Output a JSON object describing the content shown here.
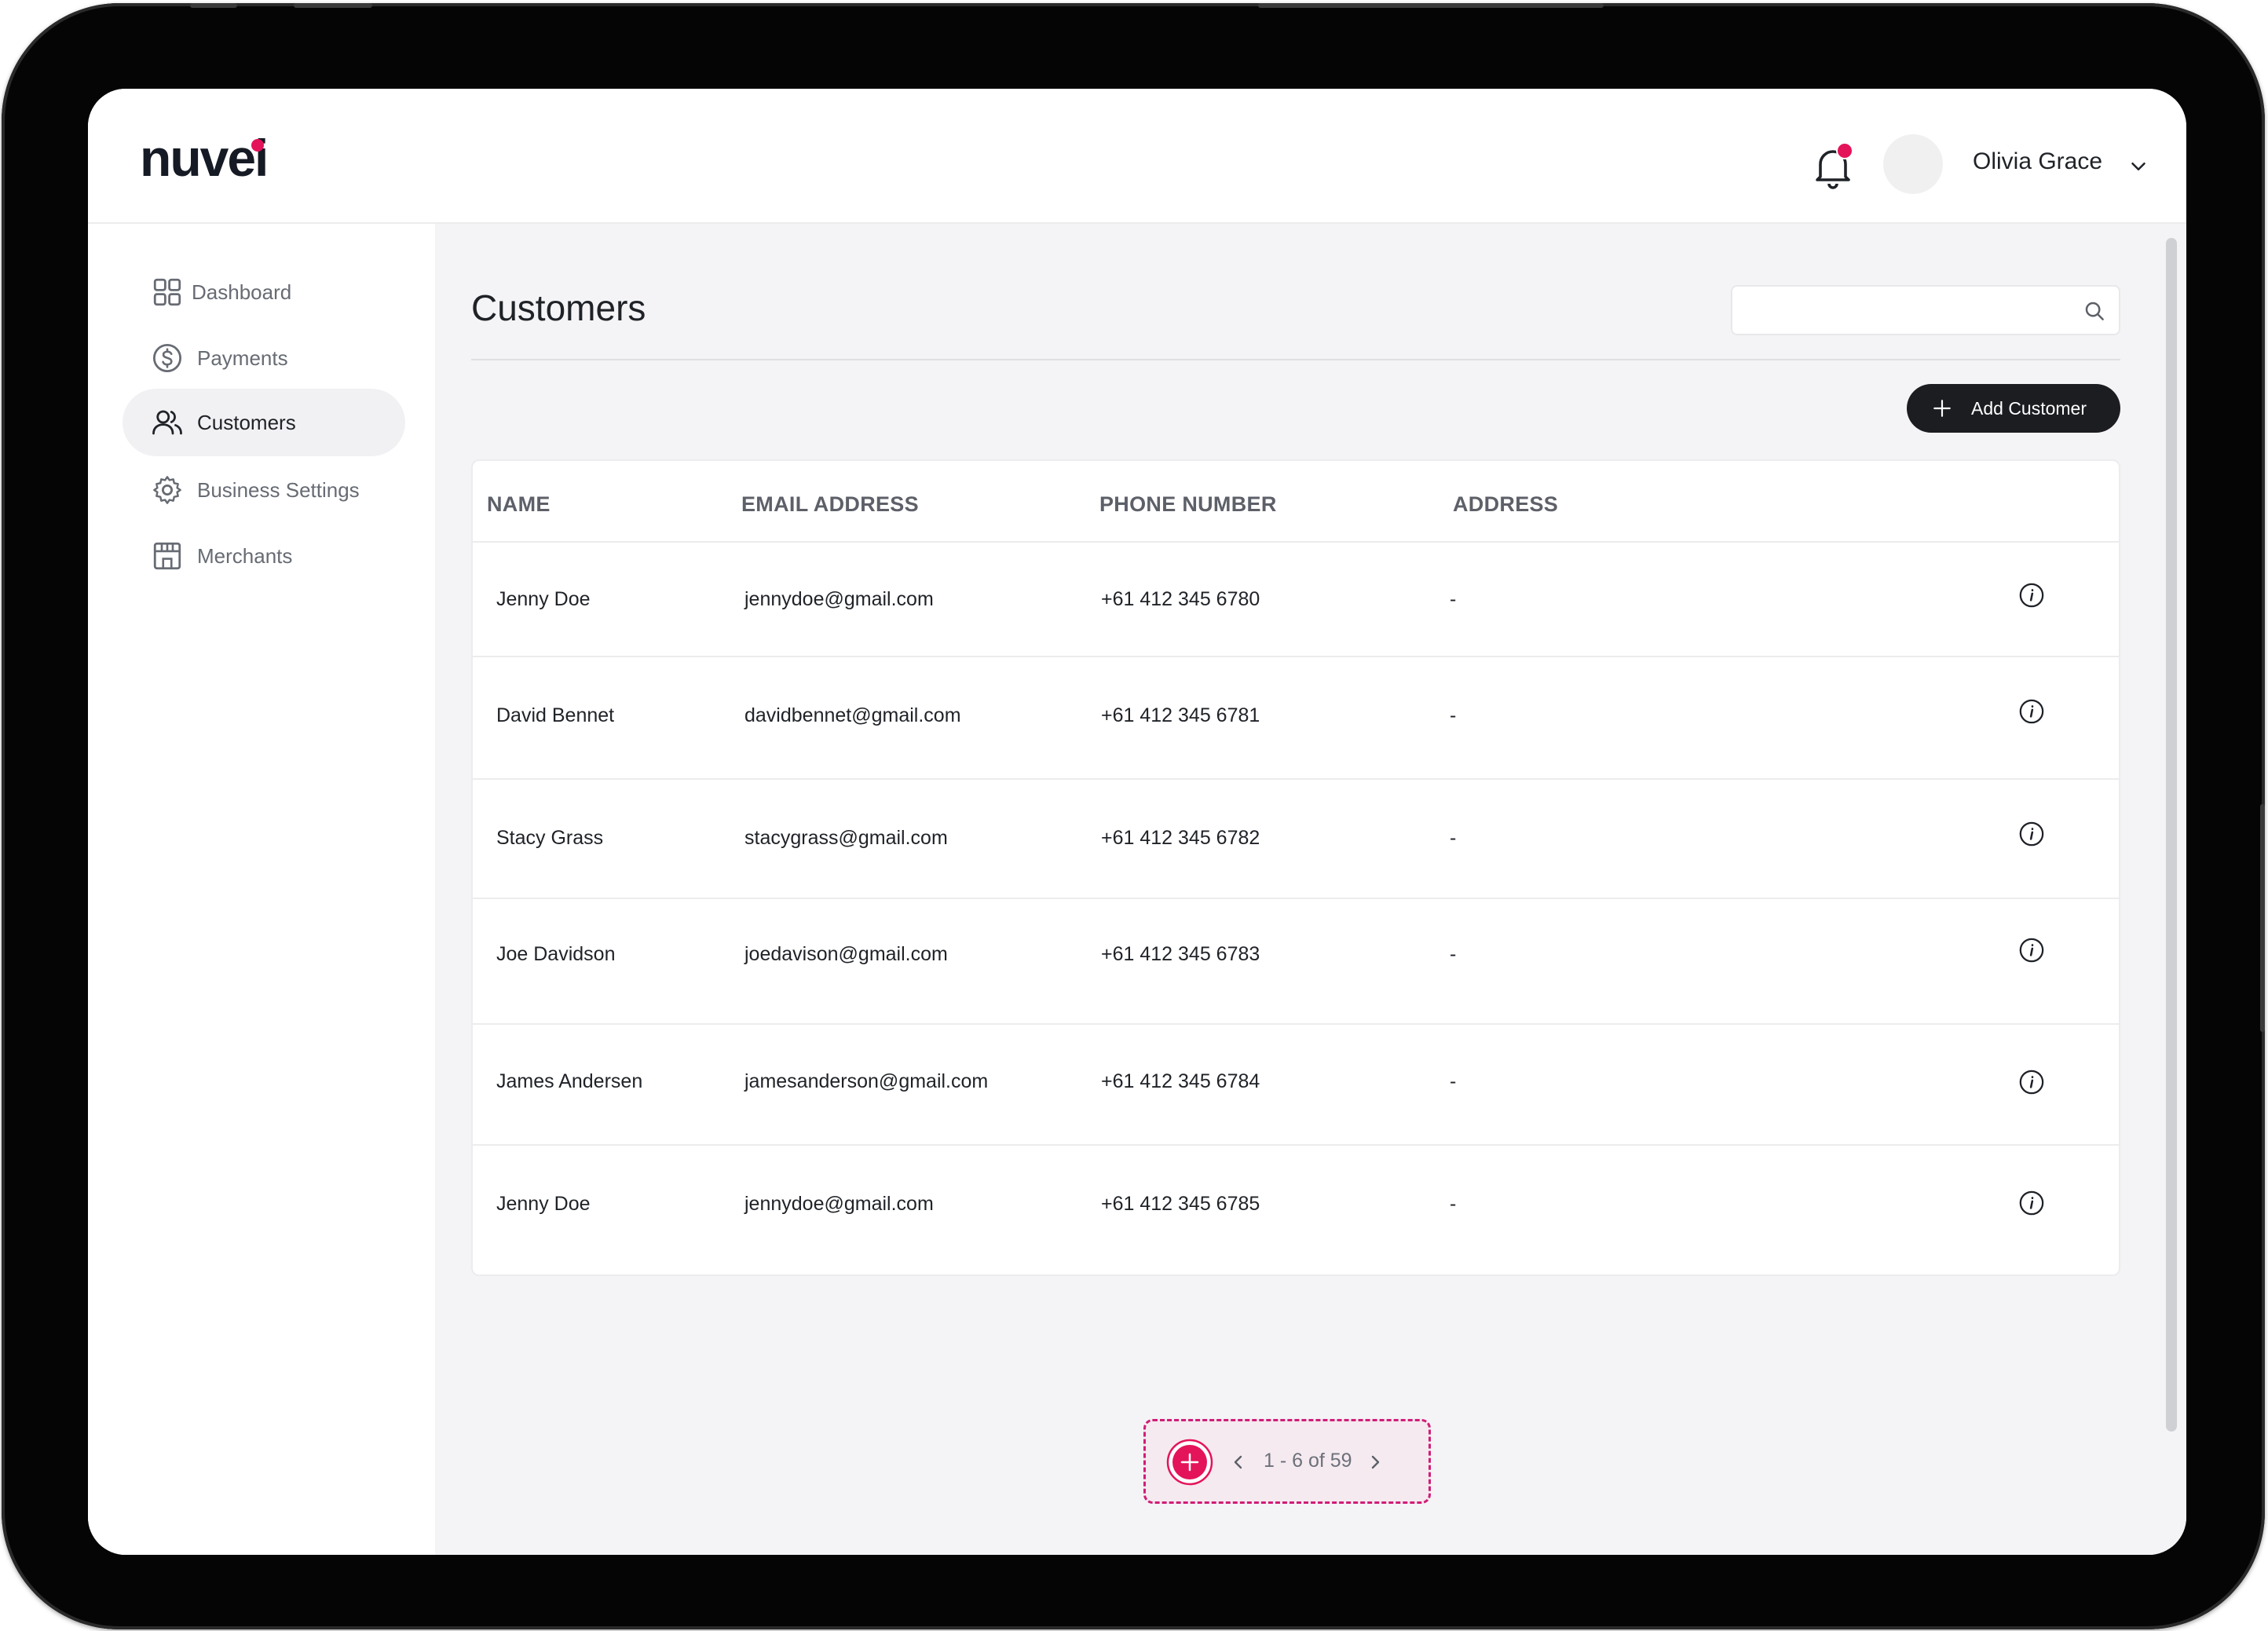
{
  "app": {
    "logo_text": "nuvei",
    "accent_color": "#e4145a",
    "dark_color": "#1c1d21"
  },
  "header": {
    "notification_icon": "bell-icon",
    "user_name": "Olivia Grace",
    "user_menu_icon": "chevron-down-icon"
  },
  "sidebar": {
    "items": [
      {
        "label": "Dashboard",
        "icon": "grid-icon",
        "active": false
      },
      {
        "label": "Payments",
        "icon": "dollar-circle-icon",
        "active": false
      },
      {
        "label": "Customers",
        "icon": "users-icon",
        "active": true
      },
      {
        "label": "Business Settings",
        "icon": "gear-icon",
        "active": false
      },
      {
        "label": "Merchants",
        "icon": "store-icon",
        "active": false
      }
    ]
  },
  "main": {
    "title": "Customers",
    "search": {
      "placeholder": "",
      "value": "",
      "icon": "search-icon"
    },
    "add_button_label": "Add Customer",
    "table": {
      "columns": [
        "NAME",
        "EMAIL ADDRESS",
        "PHONE NUMBER",
        "ADDRESS"
      ],
      "rows": [
        {
          "name": "Jenny Doe",
          "email": "jennydoe@gmail.com",
          "phone": "+61 412 345 6780",
          "address": "-"
        },
        {
          "name": "David Bennet",
          "email": "davidbennet@gmail.com",
          "phone": "+61 412 345 6781",
          "address": "-"
        },
        {
          "name": "Stacy Grass",
          "email": "stacygrass@gmail.com",
          "phone": "+61 412 345 6782",
          "address": "-"
        },
        {
          "name": "Joe Davidson",
          "email": "joedavison@gmail.com",
          "phone": "+61 412 345 6783",
          "address": "-"
        },
        {
          "name": "James Andersen",
          "email": "jamesanderson@gmail.com",
          "phone": "+61 412 345 6784",
          "address": "-"
        },
        {
          "name": "Jenny Doe",
          "email": "jennydoe@gmail.com",
          "phone": "+61 412 345 6785",
          "address": "-"
        }
      ]
    },
    "pagination": {
      "text": "1 - 6 of 59",
      "prev_icon": "chevron-left-icon",
      "next_icon": "chevron-right-icon",
      "add_icon": "plus-circle-icon"
    }
  }
}
